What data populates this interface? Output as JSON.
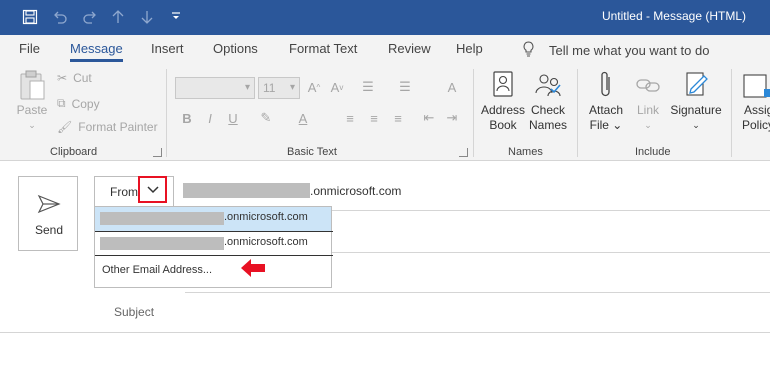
{
  "window": {
    "title": "Untitled  -  Message (HTML)",
    "accent_color": "#2b579a"
  },
  "quick_access": [
    "save-icon",
    "undo-icon",
    "redo-icon",
    "up-arrow-icon",
    "down-arrow-icon",
    "customize-icon"
  ],
  "menu": {
    "tabs": [
      "File",
      "Message",
      "Insert",
      "Options",
      "Format Text",
      "Review",
      "Help"
    ],
    "active_tab": "Message",
    "tell_me": "Tell me what you want to do"
  },
  "ribbon": {
    "clipboard": {
      "label": "Clipboard",
      "paste": "Paste",
      "cut": "Cut",
      "copy": "Copy",
      "format_painter": "Format Painter"
    },
    "basic_text": {
      "label": "Basic Text",
      "font_size": "11"
    },
    "names": {
      "label": "Names",
      "address_book_1": "Address",
      "address_book_2": "Book",
      "check_names_1": "Check",
      "check_names_2": "Names"
    },
    "include": {
      "label": "Include",
      "attach_1": "Attach",
      "attach_2": "File",
      "link": "Link",
      "signature": "Signature"
    },
    "tags": {
      "assign_1": "Assig",
      "assign_2": "Policy"
    }
  },
  "compose": {
    "send": "Send",
    "from": "From",
    "from_account_suffix": ".onmicrosoft.com",
    "dropdown": {
      "accounts": [
        {
          "suffix": ".onmicrosoft.com",
          "selected": true
        },
        {
          "suffix": ".onmicrosoft.com",
          "selected": false
        }
      ],
      "other": "Other Email Address..."
    },
    "subject_label": "Subject"
  }
}
